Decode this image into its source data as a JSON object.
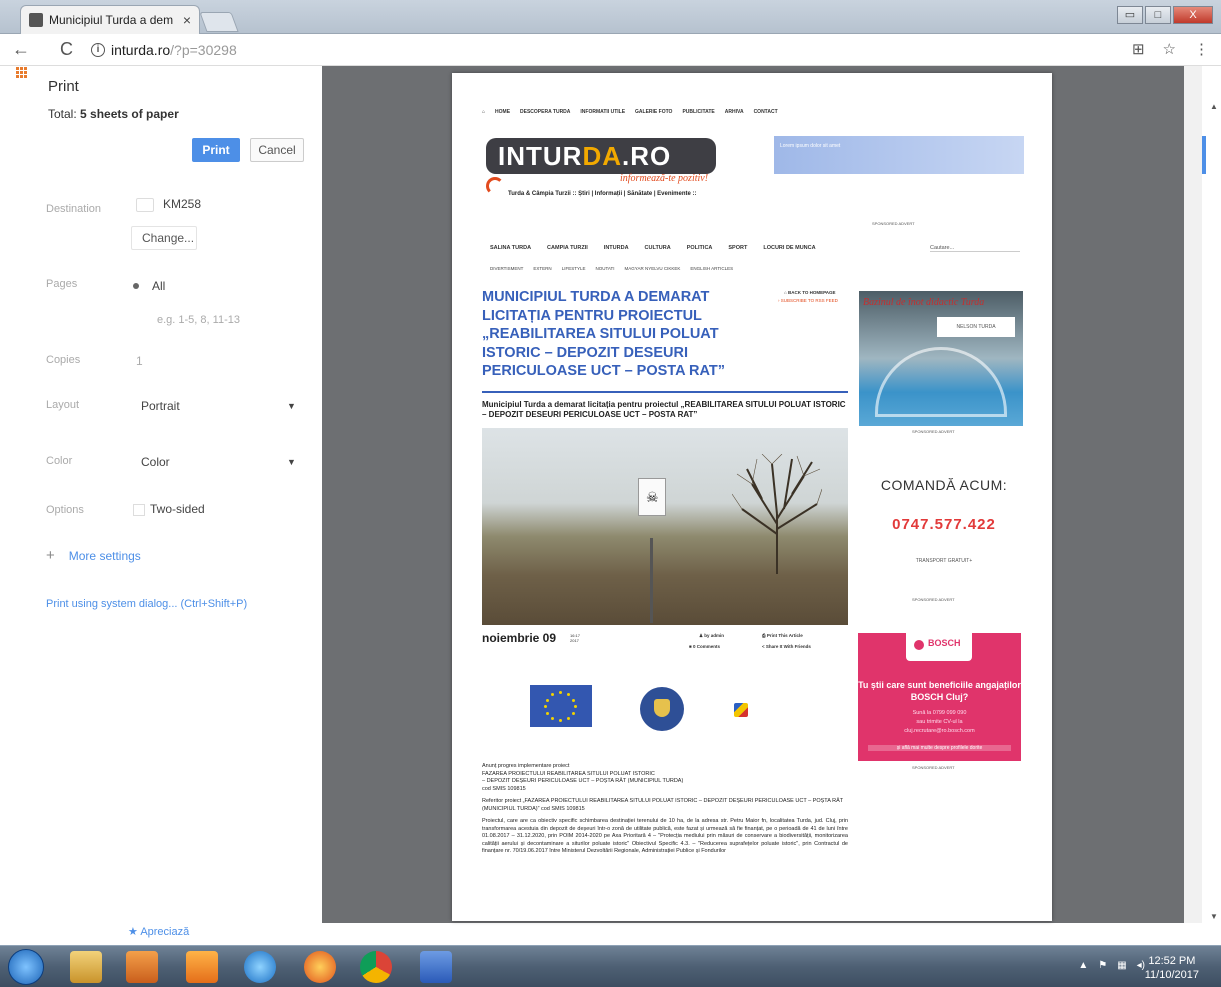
{
  "browser": {
    "tab_title": "Municipiul Turda a dem",
    "tab_close": "×",
    "url_host": "inturda.ro",
    "url_path": "/?p=30298",
    "nav_back": "←",
    "reload": "C",
    "info": "i",
    "translate_icon": "⊞",
    "star_icon": "☆",
    "menu_icon": "⋮",
    "win_min": "▭",
    "win_restore": "□",
    "win_close": "X"
  },
  "print_panel": {
    "title": "Print",
    "total_label": "Total:",
    "total_value": "5 sheets of paper",
    "print_button": "Print",
    "cancel_button": "Cancel",
    "destination_label": "Destination",
    "destination_value": "KM258",
    "change_button": "Change...",
    "pages_label": "Pages",
    "pages_value": "All",
    "pages_hint": "e.g. 1-5, 8, 11-13",
    "copies_label": "Copies",
    "copies_value": "1",
    "layout_label": "Layout",
    "layout_value": "Portrait",
    "color_label": "Color",
    "color_value": "Color",
    "options_label": "Options",
    "options_value": "Two-sided",
    "more_settings": "More settings",
    "system_dialog": "Print using system dialog... (Ctrl+Shift+P)",
    "apreciaza": "Apreciază"
  },
  "site": {
    "top_nav": [
      "HOME",
      "DESCOPERA TURDA",
      "INFORMATII UTILE",
      "GALERIE FOTO",
      "PUBLICITATE",
      "ARHIVA",
      "CONTACT"
    ],
    "logo_left": "INTUR",
    "logo_mid": "DA",
    "logo_right": ".RO",
    "logo_slogan": "informează-te pozitiv!",
    "tagline": "Turda & Câmpia Turzii  :: Știri | Informații | Sănătate | Evenimente ::",
    "sponsored_advert": "SPONSORED ADVERT",
    "categories": [
      "SALINA TURDA",
      "CAMPIA TURZII",
      "INTURDA",
      "CULTURA",
      "POLITICA",
      "SPORT",
      "LOCURI DE MUNCA"
    ],
    "categories2": [
      "DIVERTISMENT",
      "EXTERN",
      "LIFESTYLE",
      "NOUTATI",
      "MAGYAR NYELVU CIKKEK",
      "ENGLISH ARTICLES"
    ],
    "search_placeholder": "Cautare..."
  },
  "article": {
    "headline": "Municipiul Turda a demarat licitația pentru proiectul „Reabilitarea sitului poluat istoric – Depozit deseuri periculoase UCT – Posta Rat”",
    "back_home": "BACK TO HOMEPAGE",
    "subscribe": "SUBSCRIBE TO RSS FEED",
    "summary": "Municipiul Turda a demarat licitația pentru proiectul „REABILITAREA SITULUI POLUAT ISTORIC – DEPOZIT DESEURI PERICULOASE UCT – POSTA RAT”",
    "date_big": "noiembrie 09",
    "date_small_time": "16:17",
    "date_small_year": "2017",
    "by_admin": "by admin",
    "comments": "0 Comments",
    "print_article": "Print This Article",
    "share": "Share It With Friends",
    "p1_title": "Anunț progres implementare proiect",
    "p1_l1": "FAZAREA PROIECTULUI REABILITAREA SITULUI POLUAT ISTORIC",
    "p1_l2": "– DEPOZIT DEȘEURI PERICULOASE UCT – POȘTA RÂT (MUNICIPIUL TURDA)",
    "p1_l3": "cod SMIS 109815",
    "p2": "Referitor proiect „FAZAREA PROIECTULUI REABILITAREA SITULUI POLUAT ISTORIC – DEPOZIT DEȘEURI PERICULOASE UCT – POȘTA RÂT (MUNICIPIUL TURDA)” cod SMIS 109815",
    "p3": "Proiectul, care are ca obiectiv specific schimbarea destinației terenului de 10 ha, de la adresa str. Petru Maior fn, localitatea Turda, jud. Cluj, prin transformarea acestuia din depozit de deșeuri într-o zonă de utilitate publică, este fazat și urmează să fie finanțat, pe o perioadă de 41 de luni între 01.08.2017 – 31.12.2020, prin POIM 2014-2020 pe Axa Prioritară 4 – \"Protecția mediului prin măsuri de conservare a biodiversității, monitorizarea calității aerului și decontaminare a siturilor poluate istoric\" Obiectivul Specific 4.3. – \"Reducerea suprafețelor poluate istoric\", prin Contractul de finanțare nr. 70/19.06.2017 între Ministerul Dezvoltării Regionale, Administrației Publice și Fondurilor"
  },
  "sidebar": {
    "ad1_title": "Bazinul de înot didactic Turda",
    "ad1_logo": "NELSON TURDA",
    "banner_top_text": "Lorem ipsum dolor sit amet",
    "order_title": "COMANDĂ ACUM:",
    "order_phone": "0747.577.422",
    "order_transport": "TRANSPORT GRATUIT+",
    "bosch_name": "BOSCH",
    "bosch_question": "Tu știi care sunt beneficiile angajaților BOSCH Cluj?",
    "bosch_call": "Sună la 0799 099 090",
    "bosch_or": "sau trimite CV-ul la",
    "bosch_email": "cluj.recrutare@ro.bosch.com",
    "bosch_footer": "și află mai multe despre profilele dorite"
  },
  "taskbar": {
    "time": "12:52 PM",
    "date": "11/10/2017"
  },
  "colors": {
    "accent": "#4d8fe7",
    "headline": "#3760ba",
    "phone": "#e23a3a",
    "bosch": "#e0346b"
  }
}
